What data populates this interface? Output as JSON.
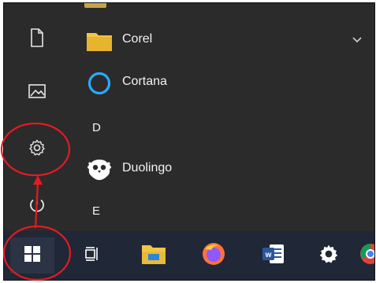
{
  "list": {
    "items": [
      {
        "label": "Corel",
        "icon": "folder-icon"
      },
      {
        "label": "Cortana",
        "icon": "cortana-icon"
      },
      {
        "label": "Duolingo",
        "icon": "duolingo-icon"
      }
    ],
    "sections": [
      "D",
      "E"
    ]
  },
  "rail": {
    "icons": [
      "document-icon",
      "pictures-icon",
      "settings-icon",
      "power-icon"
    ]
  },
  "taskbar": {
    "icons": [
      "windows-start-icon",
      "task-view-icon",
      "file-explorer-icon",
      "firefox-icon",
      "word-icon",
      "settings-app-icon",
      "chrome-icon"
    ]
  },
  "colors": {
    "background": "#2b2b2b",
    "taskbar": "#202737",
    "annotation": "#e31b23",
    "folder": "#f4c542",
    "cortana": "#2aa9ff",
    "word": "#2b579a"
  }
}
